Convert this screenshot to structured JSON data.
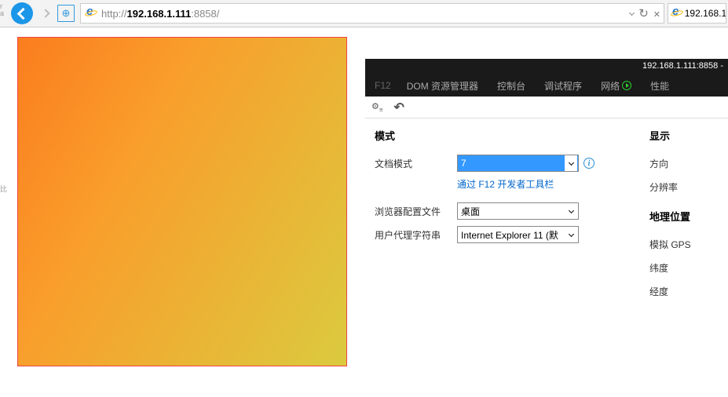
{
  "addressbar": {
    "protocol": "http://",
    "host": "192.168.1.111",
    "port": ":8858/",
    "tab_label": "192.168.1."
  },
  "left_margin_text": "比",
  "left_margin_top": "r\na",
  "devtools": {
    "title": "192.168.1.111:8858 -",
    "tabs": {
      "f12": "F12",
      "dom": "DOM 资源管理器",
      "console": "控制台",
      "debugger": "调试程序",
      "network": "网络",
      "perf": "性能"
    },
    "section_mode": "模式",
    "section_display": "显示",
    "section_geo": "地理位置",
    "labels": {
      "doc_mode": "文档模式",
      "via_f12": "通过 F12 开发者工具栏",
      "browser_profile": "浏览器配置文件",
      "ua_string": "用户代理字符串",
      "direction": "方向",
      "resolution": "分辨率",
      "sim_gps": "模拟 GPS",
      "lat": "纬度",
      "lon": "经度"
    },
    "values": {
      "doc_mode": "7",
      "browser_profile": "桌面",
      "ua_string": "Internet Explorer 11 (默"
    }
  }
}
